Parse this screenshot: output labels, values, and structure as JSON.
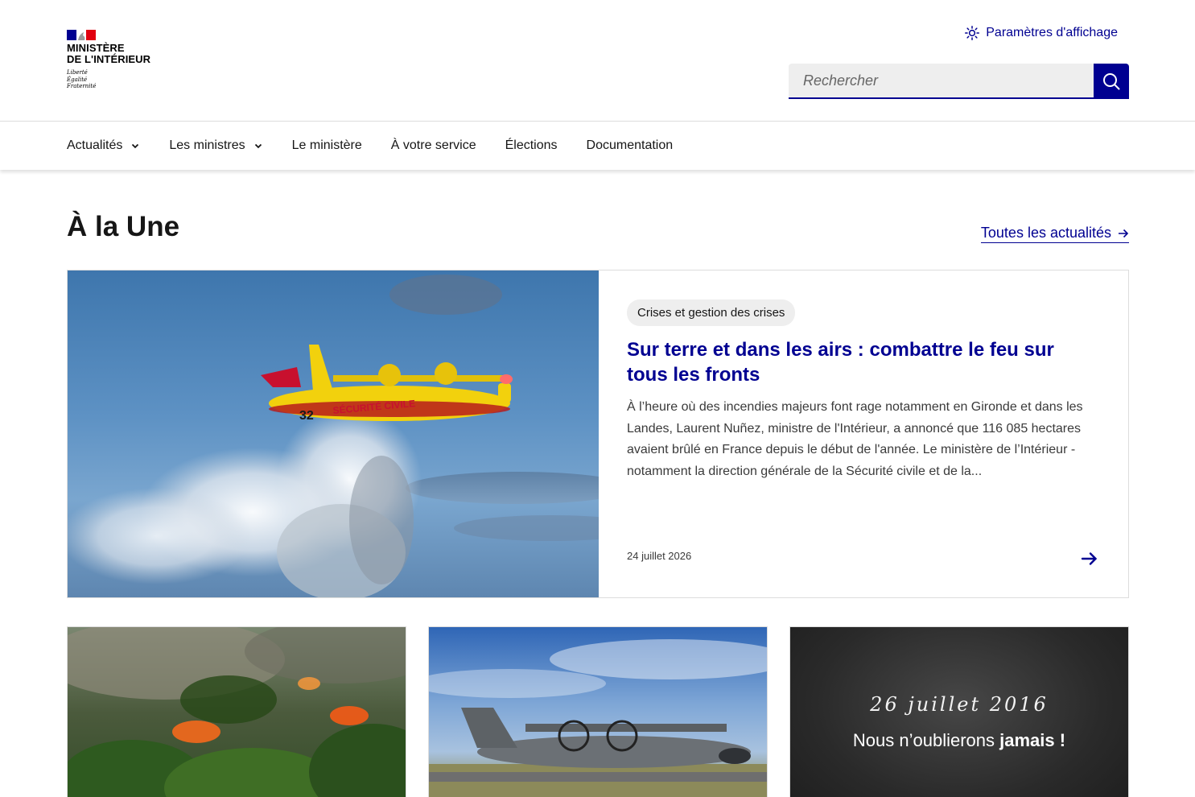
{
  "header": {
    "logo": {
      "title_line1": "MINISTÈRE",
      "title_line2": "DE L'INTÉRIEUR",
      "motto": [
        "Liberté",
        "Égalité",
        "Fraternité"
      ],
      "flag_colors": [
        "#000091",
        "#ffffff",
        "#e1000f"
      ]
    },
    "display_settings_label": "Paramètres d'affichage",
    "search": {
      "placeholder": "Rechercher"
    }
  },
  "nav": {
    "items": [
      {
        "label": "Actualités",
        "has_dropdown": true
      },
      {
        "label": "Les ministres",
        "has_dropdown": true
      },
      {
        "label": "Le ministère",
        "has_dropdown": false
      },
      {
        "label": "À votre service",
        "has_dropdown": false
      },
      {
        "label": "Élections",
        "has_dropdown": false
      },
      {
        "label": "Documentation",
        "has_dropdown": false
      }
    ]
  },
  "section": {
    "title": "À la Une",
    "all_news_label": "Toutes les actualités"
  },
  "main_card": {
    "tag": "Crises et gestion des crises",
    "title": "Sur terre et dans les airs : combattre le feu sur tous les fronts",
    "description": "À l’heure où des incendies majeurs font rage notamment en Gironde et dans les Landes, Laurent Nuñez, ministre de l'Intérieur, a annoncé que 116 085 hectares avaient brûlé en France depuis le début de l'année. Le ministère de l’Intérieur - notamment la direction générale de la Sécurité civile et de la...",
    "date": "24 juillet 2026",
    "image": {
      "plane_number": "32",
      "plane_livery": "SÉCURITÉ CIVILE"
    }
  },
  "small_cards": {
    "memorial": {
      "date": "26 juillet 2016",
      "text_regular": "Nous n’oublierons ",
      "text_bold": "jamais !"
    }
  },
  "colors": {
    "primary": "#000091",
    "text": "#161616",
    "tag_bg": "#eeeeee",
    "border": "#dddddd"
  }
}
